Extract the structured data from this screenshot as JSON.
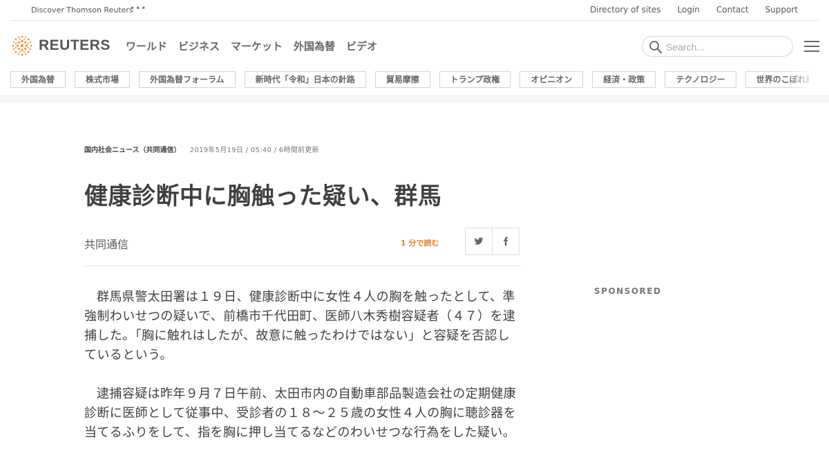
{
  "utility": {
    "discover": "Discover Thomson Reuters",
    "more_icon": "ellipsis-icon",
    "links": [
      "Directory of sites",
      "Login",
      "Contact",
      "Support"
    ]
  },
  "header": {
    "logo_text": "REUTERS",
    "logo_icon": "reuters-dot-ring-icon",
    "nav": [
      "ワールド",
      "ビジネス",
      "マーケット",
      "外国為替",
      "ビデオ"
    ],
    "search_placeholder": "Search...",
    "search_icon": "search-icon",
    "menu_icon": "hamburger-icon"
  },
  "topics": [
    "外国為替",
    "株式市場",
    "外国為替フォーラム",
    "新時代「令和」日本の針路",
    "貿易摩擦",
    "トランプ政権",
    "オピニオン",
    "経済・政策",
    "テクノロジー",
    "世界のこぼれ話"
  ],
  "article": {
    "section": "国内社会ニュース（共同通信）",
    "date": "2019年5月19日 / 05:40 / 6時間前更新",
    "headline": "健康診断中に胸触った疑い、群馬",
    "byline": "共同通信",
    "read_time": "1 分で読む",
    "share_icons": [
      "twitter-icon",
      "facebook-icon"
    ],
    "paragraphs": [
      "群馬県警太田署は１９日、健康診断中に女性４人の胸を触ったとして、準強制わいせつの疑いで、前橋市千代田町、医師八木秀樹容疑者（４７）を逮捕した。「胸に触れはしたが、故意に触ったわけではない」と容疑を否認しているという。",
      "逮捕容疑は昨年９月７日午前、太田市内の自動車部品製造会社の定期健康診断に医師として従事中、受診者の１８～２５歳の女性４人の胸に聴診器を当てるふりをして、指を胸に押し当てるなどのわいせつな行為をした疑い。"
    ]
  },
  "sidebar": {
    "sponsored": "SPONSORED"
  },
  "colors": {
    "accent_orange": "#e5822b",
    "text": "#404040"
  }
}
